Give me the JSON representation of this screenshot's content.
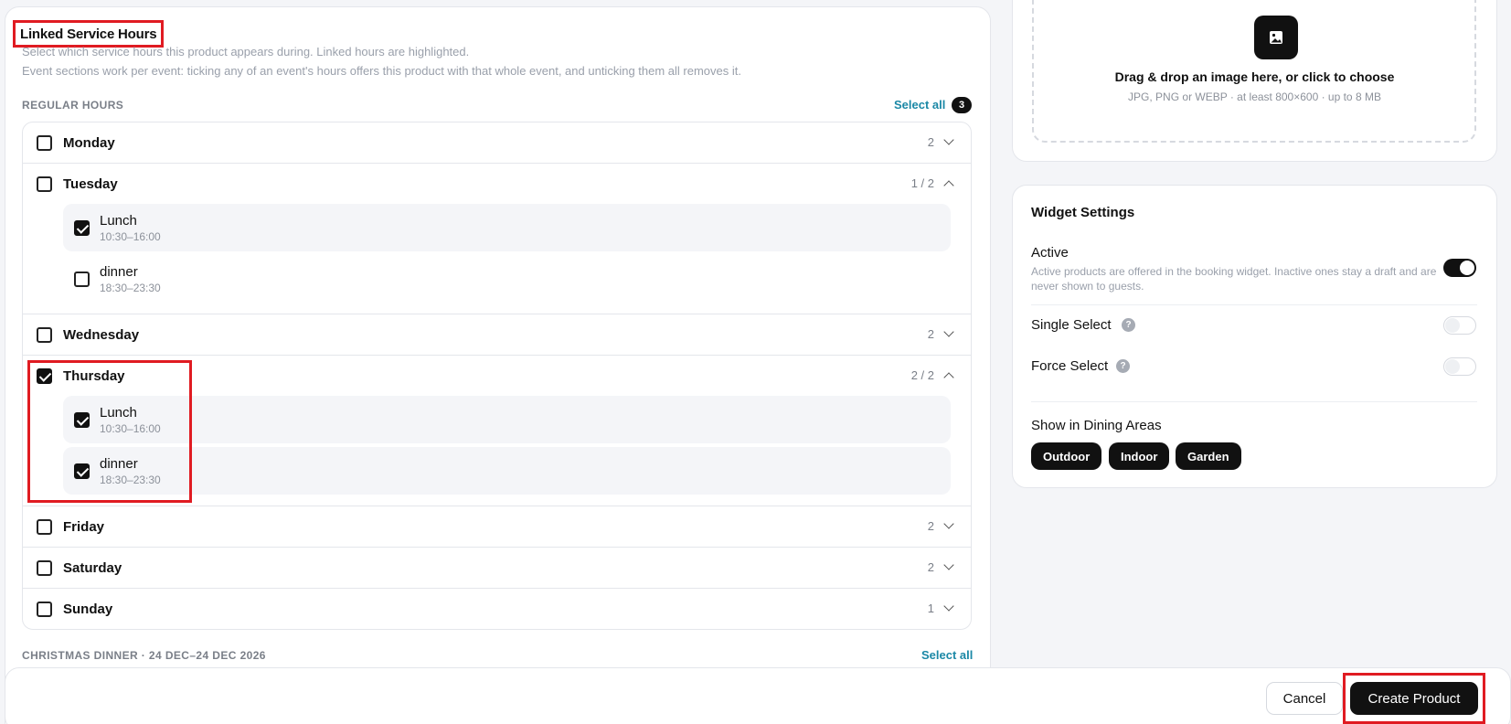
{
  "linked_hours": {
    "title": "Linked Service Hours",
    "desc1": "Select which service hours this product appears during. Linked hours are highlighted.",
    "desc2": "Event sections work per event: ticking any of an event's hours offers this product with that whole event, and unticking them all removes it.",
    "regular_label": "REGULAR HOURS",
    "select_all": "Select all",
    "selected_count": "3",
    "days": [
      {
        "name": "Monday",
        "count": "2",
        "checked": false,
        "expanded": false
      },
      {
        "name": "Tuesday",
        "count": "1 / 2",
        "checked": false,
        "expanded": true,
        "slots": [
          {
            "name": "Lunch",
            "time": "10:30–16:00",
            "checked": true
          },
          {
            "name": "dinner",
            "time": "18:30–23:30",
            "checked": false
          }
        ]
      },
      {
        "name": "Wednesday",
        "count": "2",
        "checked": false,
        "expanded": false
      },
      {
        "name": "Thursday",
        "count": "2 / 2",
        "checked": true,
        "expanded": true,
        "slots": [
          {
            "name": "Lunch",
            "time": "10:30–16:00",
            "checked": true
          },
          {
            "name": "dinner",
            "time": "18:30–23:30",
            "checked": true
          }
        ]
      },
      {
        "name": "Friday",
        "count": "2",
        "checked": false,
        "expanded": false
      },
      {
        "name": "Saturday",
        "count": "2",
        "checked": false,
        "expanded": false
      },
      {
        "name": "Sunday",
        "count": "1",
        "checked": false,
        "expanded": false
      }
    ],
    "event_label": "CHRISTMAS DINNER · 24 DEC–24 DEC 2026",
    "event_select_all": "Select all"
  },
  "upload": {
    "title": "Drag & drop an image here, or click to choose",
    "hint": "JPG, PNG or WEBP · at least 800×600 · up to 8 MB"
  },
  "widget": {
    "title": "Widget Settings",
    "active_label": "Active",
    "active_desc": "Active products are offered in the booking widget. Inactive ones stay a draft and are never shown to guests.",
    "active_on": true,
    "single_select_label": "Single Select",
    "single_select_on": false,
    "force_select_label": "Force Select",
    "force_select_on": false,
    "help_glyph": "?",
    "dining_label": "Show in Dining Areas",
    "dining_areas": [
      "Outdoor",
      "Indoor",
      "Garden"
    ]
  },
  "footer": {
    "cancel": "Cancel",
    "create": "Create Product"
  },
  "colors": {
    "accent_link": "#1b88a6",
    "annotation_red": "#e01b22",
    "primary": "#111111"
  }
}
